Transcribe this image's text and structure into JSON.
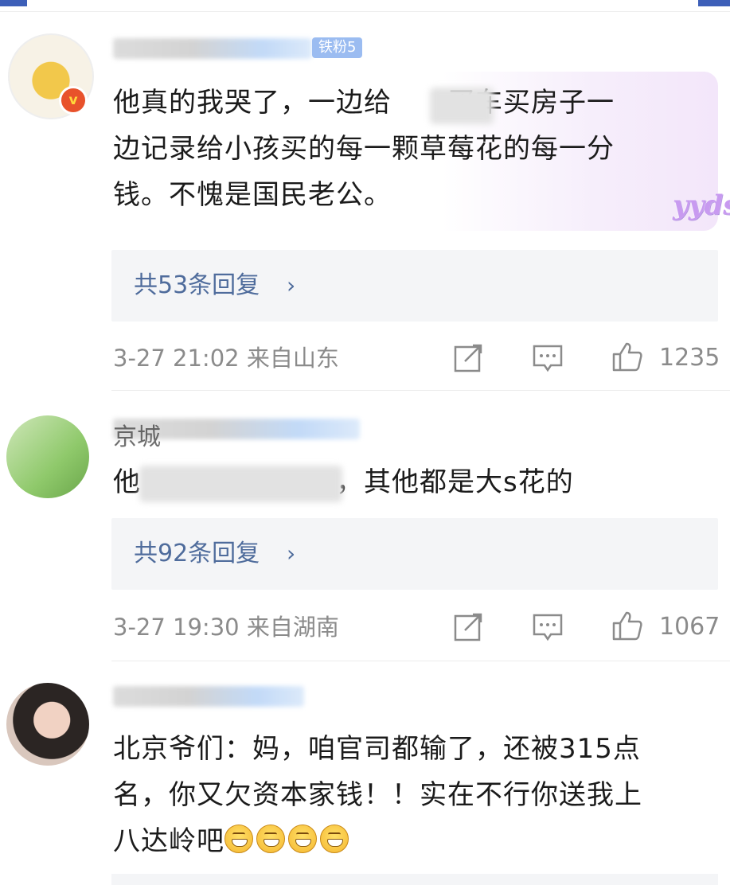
{
  "colors": {
    "accent": "#3d5fb8",
    "link": "#4f6c9c",
    "meta": "#8b8b8b",
    "verified": "#e8522b"
  },
  "comments": [
    {
      "fan_badge": "铁粉5",
      "text": "他真的我哭了，一边给　　买车买房子一\n边记录给小孩买的每一颗草莓花的每一分\n钱。不愧是国民老公。",
      "sticker": "yyds",
      "replies": "共53条回复",
      "time_location": "3-27 21:02 来自山东",
      "likes": "1235"
    },
    {
      "name_partial": "京城",
      "text": "他　　　　　　　，其他都是大s花的",
      "replies": "共92条回复",
      "time_location": "3-27 19:30 来自湖南",
      "likes": "1067"
    },
    {
      "text": "北京爷们：妈，咱官司都输了，还被315点\n名，你又欠资本家钱！！实在不行你送我上\n八达岭吧"
    }
  ],
  "icons": {
    "forward": "share-icon",
    "comment": "comment-icon",
    "like": "thumb-up-icon",
    "reply_arrow": "chevron-right-icon",
    "emoji": "grin-emoji-icon"
  }
}
